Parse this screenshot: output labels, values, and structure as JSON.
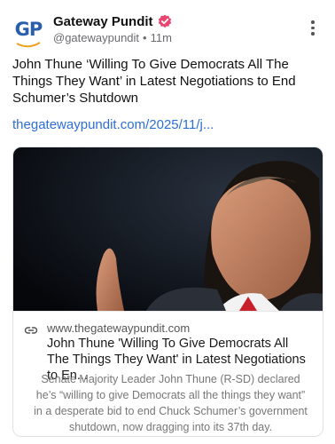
{
  "author": {
    "avatar_text": "GP",
    "display_name": "Gateway Pundit",
    "handle": "@gatewaypundit",
    "separator": "•",
    "time": "11m"
  },
  "post": {
    "text": "John Thune ‘Willing To Give Democrats All The Things They Want’ in Latest Negotiations to End Schumer’s Shutdown",
    "link": "thegatewaypundit.com/2025/11/j..."
  },
  "card": {
    "domain": "www.thegatewaypundit.com",
    "title": "John Thune 'Willing To Give Democrats All The Things They Want' in Latest Negotiations to En...",
    "description": "Senate Majority Leader John Thune (R-SD) declared he’s “willing to give Democrats all the things they want” in a desperate bid to end Chuck Schumer’s government shutdown, now dragging into its 37th day."
  },
  "colors": {
    "brand_blue": "#2a5fae",
    "link_blue": "#2d6fd6",
    "verified_pink": "#e8466e"
  },
  "icons": [
    "verified-badge-icon",
    "more-options-icon",
    "link-icon"
  ]
}
